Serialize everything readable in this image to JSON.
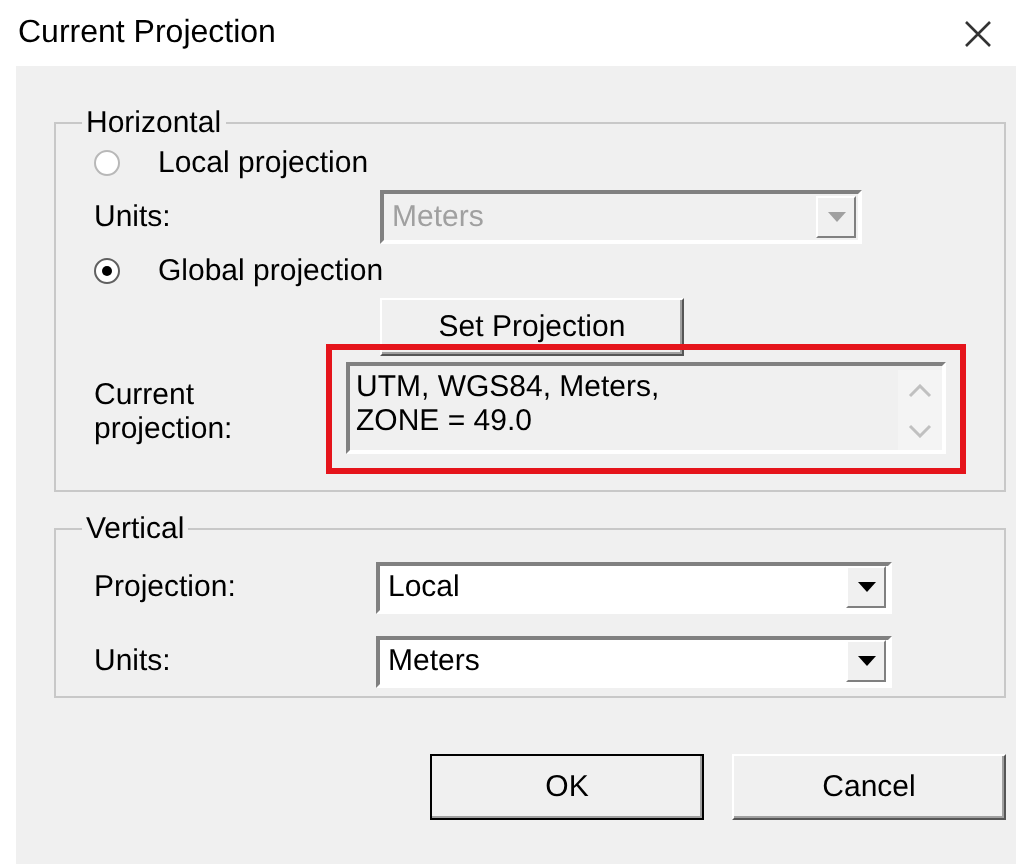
{
  "window": {
    "title": "Current Projection"
  },
  "horizontal": {
    "legend": "Horizontal",
    "local": {
      "label": "Local projection",
      "selected": false
    },
    "units": {
      "label": "Units:",
      "value": "Meters",
      "disabled": true
    },
    "global": {
      "label": "Global projection",
      "selected": true
    },
    "set_button": "Set Projection",
    "current": {
      "label": "Current\nprojection:",
      "value": "UTM, WGS84, Meters,\nZONE = 49.0",
      "highlighted": true
    }
  },
  "vertical": {
    "legend": "Vertical",
    "fields": [
      {
        "label": "Projection:",
        "value": "Local",
        "disabled": false
      },
      {
        "label": "Units:",
        "value": "Meters",
        "disabled": false
      }
    ]
  },
  "buttons": [
    {
      "label": "OK",
      "default": true
    },
    {
      "label": "Cancel",
      "default": false
    }
  ]
}
